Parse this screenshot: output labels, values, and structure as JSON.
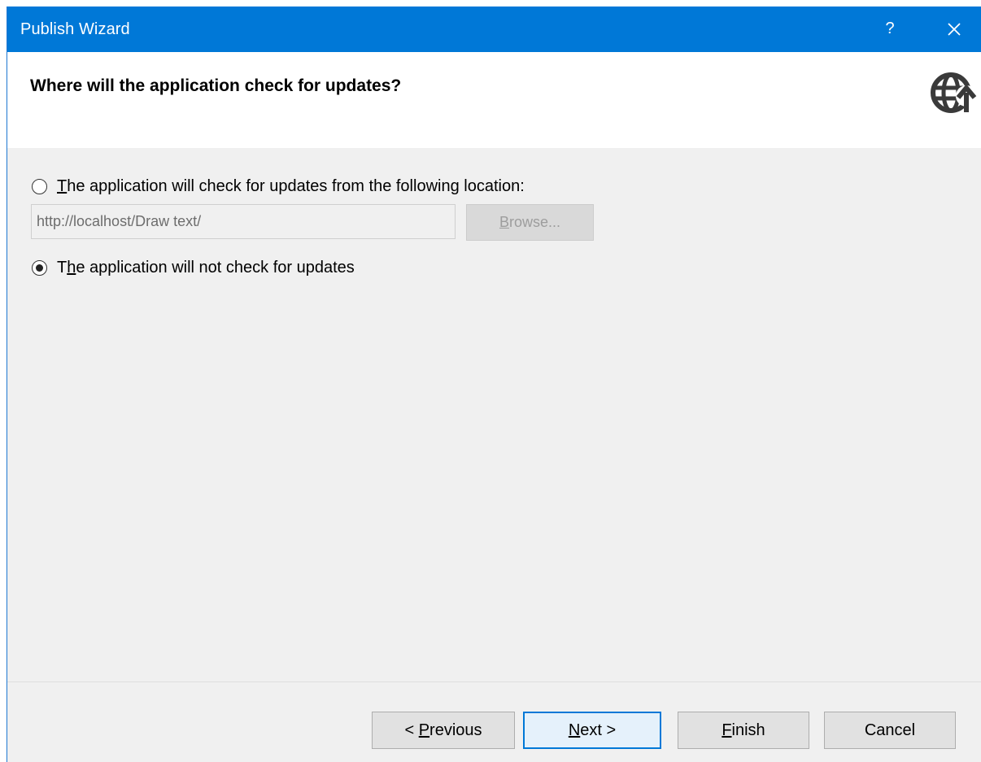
{
  "window": {
    "title": "Publish Wizard",
    "help_label": "?",
    "accent_color": "#0078d7"
  },
  "header": {
    "heading": "Where will the application check for updates?",
    "icon": "globe-update-icon"
  },
  "options": {
    "check_location": {
      "label_accel": "T",
      "label_rest": "he application will check for updates from the following location:",
      "selected": false
    },
    "url_input": {
      "value": "http://localhost/Draw text/",
      "enabled": false
    },
    "browse": {
      "label_accel": "B",
      "label_rest": "rowse...",
      "enabled": false
    },
    "no_check": {
      "label_pre": "T",
      "label_accel": "h",
      "label_rest": "e application will not check for updates",
      "selected": true
    }
  },
  "footer": {
    "previous": {
      "pre": "< ",
      "accel": "P",
      "rest": "revious"
    },
    "next": {
      "accel": "N",
      "rest": "ext >"
    },
    "finish": {
      "accel": "F",
      "rest": "inish"
    },
    "cancel": {
      "label": "Cancel"
    }
  }
}
